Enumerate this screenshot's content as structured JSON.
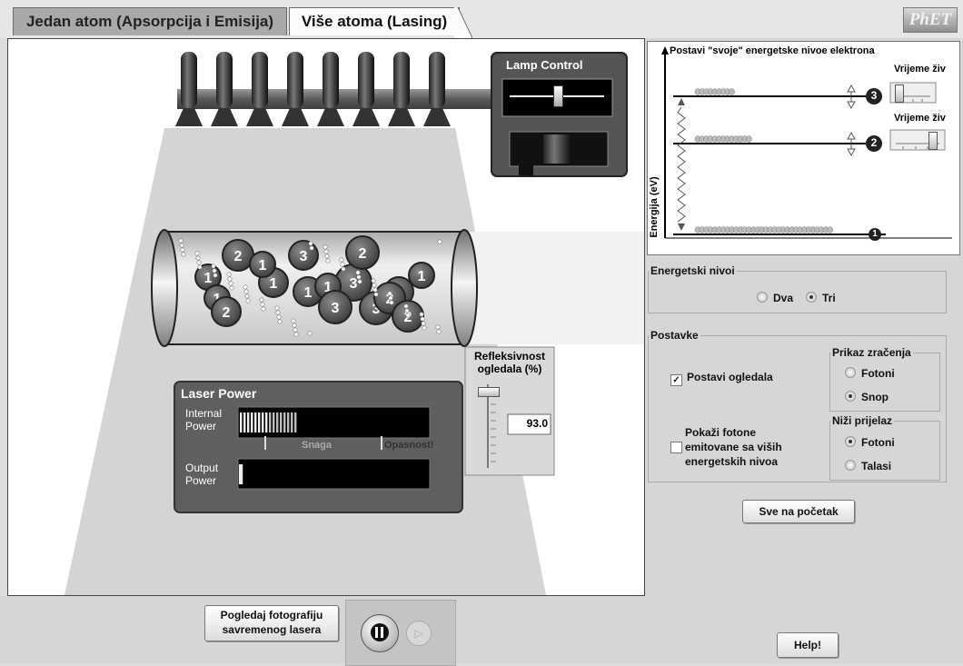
{
  "tabs": [
    {
      "label": "Jedan atom (Apsorpcija i Emisija)"
    },
    {
      "label": "Više atoma (Lasing)"
    }
  ],
  "logo": "PhET",
  "lamp_control": {
    "title": "Lamp Control",
    "intensity": 0.5
  },
  "laser_power": {
    "title": "Laser Power",
    "internal_label_1": "Internal",
    "internal_label_2": "Power",
    "output_label_1": "Output",
    "output_label_2": "Power",
    "snaga_label": "Snaga",
    "opasnost_label": "Opasnost!",
    "internal_value": 0.32,
    "output_value": 0.02
  },
  "reflectivity": {
    "title_1": "Refleksivnost",
    "title_2": "ogledala (%)",
    "value": "93.0"
  },
  "atoms": {
    "labels": [
      "2",
      "1",
      "1",
      "1",
      "3",
      "3",
      "2",
      "1",
      "1",
      "1",
      "1",
      "3",
      "3",
      "2",
      "2",
      "1",
      "2"
    ]
  },
  "energy_diagram": {
    "title": "Postavi \"svoje\" energetske nivoe elektrona",
    "y_axis": "Energija (eV)",
    "lifetime_label_3": "Vrijeme živ",
    "lifetime_label_2": "Vrijeme živ",
    "level_labels": [
      "3",
      "2",
      "1"
    ],
    "lifetime_3": 0.1,
    "lifetime_2": 0.9
  },
  "energy_levels": {
    "legend": "Energetski nivoi",
    "options": [
      "Dva",
      "Tri"
    ],
    "selected": "Tri"
  },
  "settings": {
    "legend": "Postavke",
    "mirrors": "Postavi ogledala",
    "mirrors_checked": true,
    "show_photons_1": "Pokaži fotone",
    "show_photons_2": "emitovane sa viših",
    "show_photons_3": "energetskih nivoa",
    "show_photons_checked": false,
    "radiation": {
      "legend": "Prikaz zračenja",
      "options": [
        "Fotoni",
        "Snop"
      ],
      "selected": "Snop"
    },
    "lower": {
      "legend": "Niži prijelaz",
      "options": [
        "Fotoni",
        "Talasi"
      ],
      "selected": "Fotoni"
    }
  },
  "reset_button": "Sve na početak",
  "photo_button_1": "Pogledaj fotografiju",
  "photo_button_2": "savremenog lasera",
  "help_button": "Help!"
}
